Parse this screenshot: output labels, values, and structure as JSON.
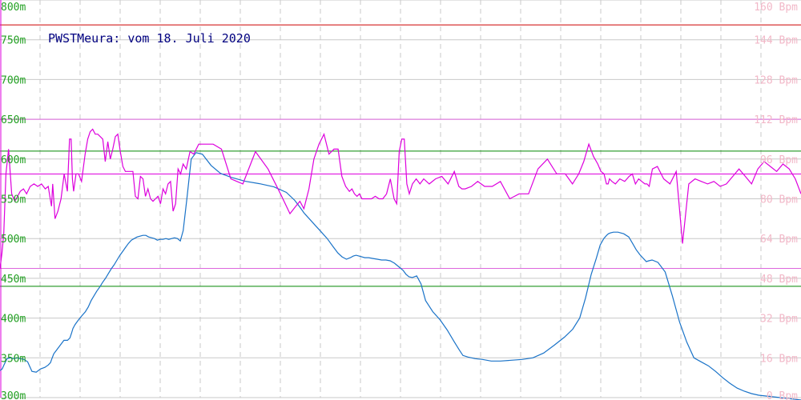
{
  "chart_data": {
    "type": "line",
    "title": "PWSTMeura: vom 18. Juli 2020",
    "x": [
      0,
      3,
      6,
      10,
      15,
      20,
      24,
      29,
      34,
      40,
      46,
      52,
      58,
      62,
      64,
      66,
      70,
      75,
      80,
      85,
      88,
      90,
      92,
      96,
      100,
      106,
      110,
      114,
      118,
      122,
      126,
      130,
      134,
      138,
      142,
      146,
      150,
      154,
      158,
      162,
      166,
      170,
      174,
      178,
      182,
      186,
      190,
      194,
      198,
      202,
      206,
      210,
      214,
      218,
      222,
      226,
      230,
      236,
      242,
      250,
      262,
      275,
      290,
      310,
      330,
      350,
      365,
      372,
      378,
      386,
      394,
      402,
      410,
      418,
      424,
      430,
      436,
      440,
      444,
      448,
      452,
      456,
      462,
      468,
      474,
      480,
      486,
      492,
      496,
      500,
      504,
      508,
      512,
      518,
      524,
      530,
      540,
      550,
      560,
      570,
      575,
      580,
      590,
      600,
      612,
      625,
      640,
      655,
      670,
      685,
      700,
      712,
      722,
      730,
      738,
      745,
      750,
      755,
      758,
      760,
      764,
      770,
      778,
      785,
      790,
      795,
      800,
      805,
      808,
      812,
      820,
      830,
      840,
      850,
      860,
      870,
      880,
      890,
      900,
      910,
      920,
      930,
      940,
      950,
      960,
      970,
      980,
      990,
      999
    ],
    "series": [
      {
        "axis": "left",
        "color": "#1a73c8",
        "values": [
          334,
          336,
          342,
          349,
          350,
          349,
          350,
          349,
          348,
          345,
          333,
          332,
          336,
          338,
          341,
          344,
          349,
          355,
          360,
          366,
          372,
          372,
          375,
          381,
          387,
          392,
          397,
          402,
          408,
          414,
          422,
          428,
          434,
          439,
          445,
          450,
          456,
          462,
          467,
          473,
          479,
          484,
          489,
          494,
          498,
          500,
          502,
          503,
          504,
          504,
          502,
          501,
          500,
          498,
          499,
          499,
          500,
          499,
          500,
          501,
          500,
          497,
          510,
          550,
          600,
          608,
          606,
          592,
          582,
          577,
          572,
          569,
          565,
          558,
          548,
          540,
          532,
          524,
          516,
          508,
          500,
          490,
          482,
          477,
          474,
          476,
          478,
          479,
          478,
          477,
          476,
          476,
          475,
          474,
          473,
          473,
          472,
          469,
          466,
          463,
          460,
          455,
          452,
          451,
          453,
          443,
          422,
          408,
          398,
          385,
          370,
          360,
          353,
          351,
          349,
          348,
          346,
          346,
          347,
          348,
          350,
          356,
          366,
          376,
          386,
          400,
          425,
          455,
          475,
          492,
          500,
          504,
          506,
          507,
          508,
          508,
          506,
          502,
          494,
          486,
          480,
          475,
          471,
          472,
          473,
          470,
          458,
          428,
          395,
          370,
          350,
          345,
          340,
          333,
          325,
          318,
          312,
          308,
          305,
          303,
          302,
          301,
          300,
          299,
          298,
          297
        ]
      },
      {
        "axis": "right",
        "color": "#dd00dd",
        "values": [
          52,
          58,
          66,
          90,
          100,
          82,
          79,
          81,
          83,
          84,
          82,
          85,
          86,
          85,
          86,
          84,
          85,
          80,
          77,
          86,
          72,
          75,
          80,
          90,
          83,
          104,
          104,
          88,
          83,
          90,
          90,
          87,
          98,
          104,
          107,
          108,
          106,
          106,
          105,
          104,
          95,
          103,
          96,
          100,
          105,
          106,
          99,
          93,
          91,
          91,
          91,
          91,
          81,
          80,
          89,
          88,
          81,
          84,
          80,
          79,
          80,
          81,
          78,
          84,
          82,
          86,
          87,
          75,
          78,
          92,
          90,
          94,
          92,
          99,
          98,
          102,
          102,
          102,
          100,
          88,
          86,
          99,
          92,
          82,
          74,
          77,
          79,
          76,
          84,
          96,
          102,
          106,
          98,
          100,
          100,
          89,
          85,
          83,
          84,
          82,
          81,
          82,
          80,
          80,
          80,
          80,
          81,
          80,
          80,
          82,
          88,
          80,
          78,
          99,
          104,
          104,
          86,
          82,
          86,
          88,
          86,
          88,
          86,
          88,
          89,
          86,
          91,
          85,
          84,
          84,
          85,
          87,
          85,
          85,
          87,
          80,
          82,
          82,
          92,
          96,
          90,
          90,
          86,
          90,
          95,
          102,
          97,
          94,
          91,
          90,
          86,
          86,
          88,
          87,
          86,
          88,
          87,
          89,
          90,
          86,
          88,
          87,
          86,
          86,
          85,
          92,
          93,
          88,
          86,
          91,
          62,
          86,
          88,
          87,
          86,
          87,
          85,
          86,
          89,
          92,
          89,
          86,
          92,
          95,
          93,
          91,
          94,
          92,
          88,
          82
        ]
      }
    ],
    "yticks_left": [
      "800m",
      "750m",
      "700m",
      "650m",
      "600m",
      "550m",
      "500m",
      "450m",
      "400m",
      "350m",
      "300m"
    ],
    "yticks_right": [
      "160 Bpm",
      "144 Bpm",
      "128 Bpm",
      "112 Bpm",
      "96 Bpm",
      "80 Bpm",
      "64 Bpm",
      "48 Bpm",
      "32 Bpm",
      "16 Bpm",
      "0 Bpm"
    ],
    "ylim_left": [
      300,
      800
    ],
    "ylim_right": [
      0,
      160
    ],
    "grid": true,
    "reference_lines": [
      {
        "axis": "right",
        "value": 150,
        "color": "#cc0000"
      },
      {
        "axis": "right",
        "value": 112,
        "color": "#dd66dd"
      },
      {
        "axis": "right",
        "value": 90,
        "color": "#dd00dd"
      },
      {
        "axis": "right",
        "value": 52,
        "color": "#dd66dd"
      },
      {
        "axis": "left",
        "value": 610,
        "color": "#008800"
      },
      {
        "axis": "left",
        "value": 440,
        "color": "#008800"
      }
    ],
    "colors": {
      "left_ticks": "#22a022",
      "right_ticks": "#f2b8c8",
      "title": "#000080",
      "grid": "#c8c8c8"
    }
  }
}
